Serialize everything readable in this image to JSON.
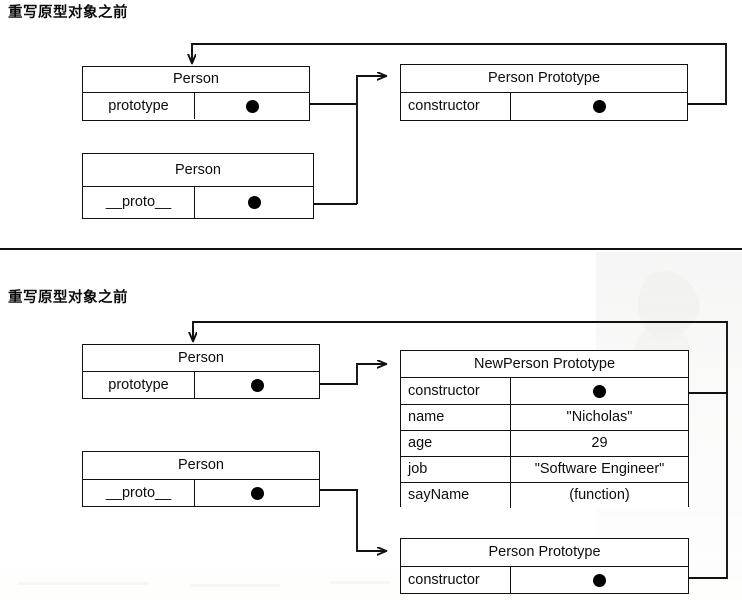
{
  "figure": {
    "type": "diagram",
    "subject": "JavaScript prototype object relationships",
    "divider_present": true
  },
  "sections": [
    {
      "id": "before-overwrite",
      "title": "重写原型对象之前",
      "boxes": [
        {
          "id": "person-constructor-top",
          "header": "Person",
          "rows": [
            {
              "key": "prototype",
              "value": "",
              "value_kind": "pointer-dot"
            }
          ]
        },
        {
          "id": "person-instance-top",
          "header": "Person",
          "rows": [
            {
              "key": "__proto__",
              "value": "",
              "value_kind": "pointer-dot"
            }
          ]
        },
        {
          "id": "person-prototype-top",
          "header": "Person Prototype",
          "rows": [
            {
              "key": "constructor",
              "value": "",
              "value_kind": "pointer-dot"
            }
          ]
        }
      ],
      "connections": [
        {
          "from": "person-constructor-top.prototype",
          "to": "person-prototype-top",
          "style": "elbow-arrow"
        },
        {
          "from": "person-instance-top.__proto__",
          "to": "person-prototype-top",
          "style": "elbow-arrow"
        },
        {
          "from": "person-prototype-top.constructor",
          "to": "person-constructor-top",
          "style": "feedback-arrow-top"
        }
      ]
    },
    {
      "id": "after-overwrite",
      "title": "重写原型对象之前",
      "boxes": [
        {
          "id": "person-constructor-bottom",
          "header": "Person",
          "rows": [
            {
              "key": "prototype",
              "value": "",
              "value_kind": "pointer-dot"
            }
          ]
        },
        {
          "id": "person-instance-bottom",
          "header": "Person",
          "rows": [
            {
              "key": "__proto__",
              "value": "",
              "value_kind": "pointer-dot"
            }
          ]
        },
        {
          "id": "newperson-prototype",
          "header": "NewPerson Prototype",
          "rows": [
            {
              "key": "constructor",
              "value": "",
              "value_kind": "pointer-dot"
            },
            {
              "key": "name",
              "value": "\"Nicholas\"",
              "value_kind": "text"
            },
            {
              "key": "age",
              "value": "29",
              "value_kind": "text"
            },
            {
              "key": "job",
              "value": "\"Software Engineer\"",
              "value_kind": "text"
            },
            {
              "key": "sayName",
              "value": "(function)",
              "value_kind": "text"
            }
          ]
        },
        {
          "id": "person-prototype-bottom",
          "header": "Person Prototype",
          "rows": [
            {
              "key": "constructor",
              "value": "",
              "value_kind": "pointer-dot"
            }
          ]
        }
      ],
      "connections": [
        {
          "from": "person-constructor-bottom.prototype",
          "to": "newperson-prototype",
          "style": "elbow-arrow"
        },
        {
          "from": "person-instance-bottom.__proto__",
          "to": "person-prototype-bottom",
          "style": "elbow-arrow"
        },
        {
          "from": "newperson-prototype.constructor",
          "to": "person-constructor-bottom",
          "style": "feedback-arrow-top"
        },
        {
          "from": "person-prototype-bottom.constructor",
          "to": "person-constructor-bottom",
          "style": "feedback-arrow-top"
        }
      ]
    }
  ],
  "colors": {
    "stroke": "#111111",
    "text": "#0d0d0d",
    "background": "#ffffff",
    "dot": "#000000"
  }
}
